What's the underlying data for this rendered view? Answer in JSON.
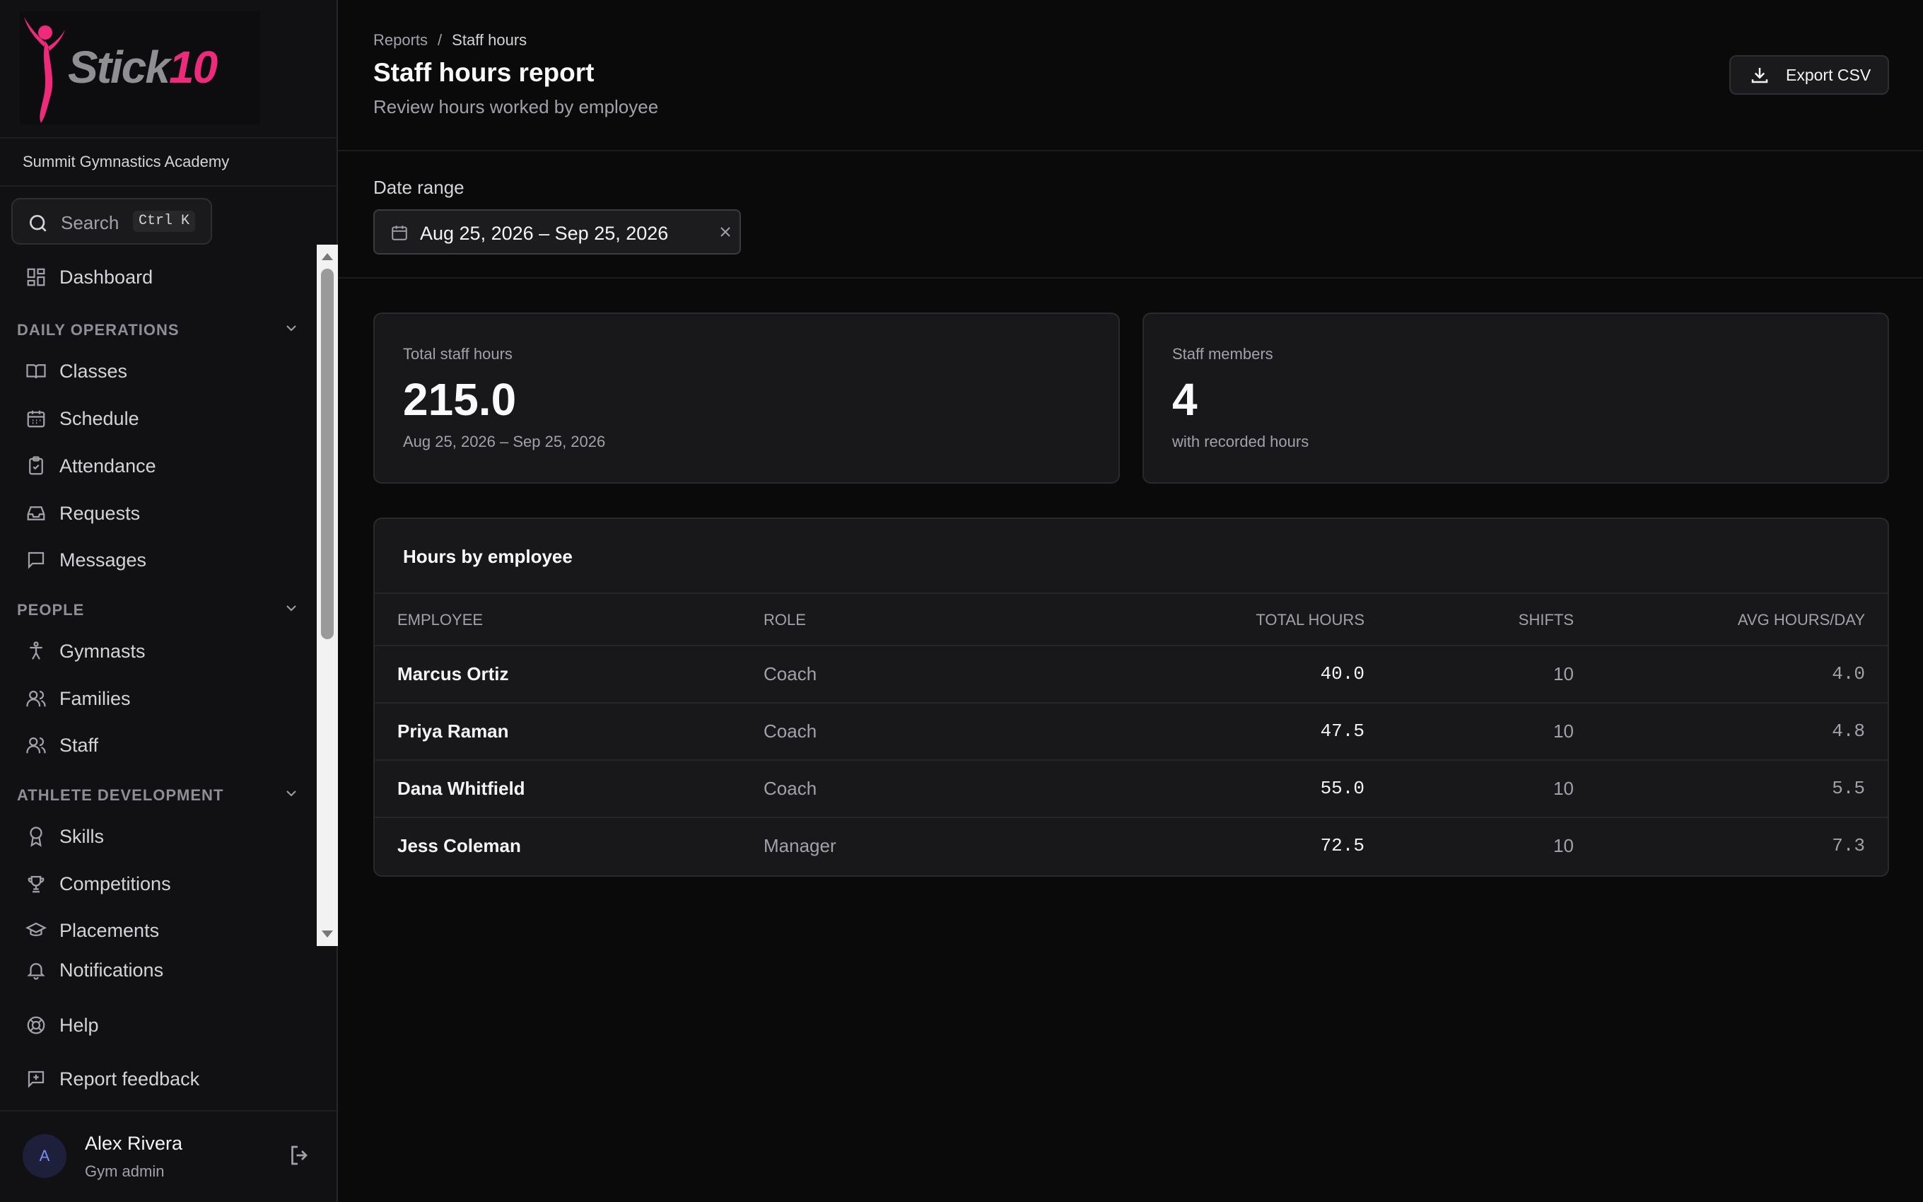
{
  "brand": {
    "logo_text": "Stick",
    "logo_accent": "10",
    "org_name": "Summit Gymnastics Academy",
    "accent_color": "#ee2a7b"
  },
  "search": {
    "label": "Search",
    "shortcut": "Ctrl K"
  },
  "sidebar": {
    "dashboard": {
      "label": "Dashboard",
      "icon": "dashboard-icon"
    },
    "sections": [
      {
        "label": "Daily operations",
        "items": [
          {
            "label": "Classes",
            "icon": "book-icon"
          },
          {
            "label": "Schedule",
            "icon": "calendar-icon"
          },
          {
            "label": "Attendance",
            "icon": "clipboard-check-icon"
          },
          {
            "label": "Requests",
            "icon": "inbox-icon"
          },
          {
            "label": "Messages",
            "icon": "message-icon"
          }
        ]
      },
      {
        "label": "People",
        "items": [
          {
            "label": "Gymnasts",
            "icon": "person-icon"
          },
          {
            "label": "Families",
            "icon": "users-icon"
          },
          {
            "label": "Staff",
            "icon": "users-icon"
          }
        ]
      },
      {
        "label": "Athlete development",
        "items": [
          {
            "label": "Skills",
            "icon": "award-icon"
          },
          {
            "label": "Competitions",
            "icon": "trophy-icon"
          },
          {
            "label": "Placements",
            "icon": "graduation-cap-icon"
          }
        ]
      }
    ],
    "footer_items": [
      {
        "label": "Notifications",
        "icon": "bell-icon"
      },
      {
        "label": "Help",
        "icon": "lifebuoy-icon"
      },
      {
        "label": "Report feedback",
        "icon": "feedback-icon"
      }
    ]
  },
  "user": {
    "initial": "A",
    "name": "Alex Rivera",
    "role": "Gym admin"
  },
  "header": {
    "breadcrumb": [
      "Reports",
      "/",
      "Staff hours"
    ],
    "title": "Staff hours report",
    "subtitle": "Review hours worked by employee",
    "export_label": "Export CSV"
  },
  "filter": {
    "label": "Date range",
    "value": "Aug 25, 2026 – Sep 25, 2026"
  },
  "stats": [
    {
      "label": "Total staff hours",
      "value": "215.0",
      "foot": "Aug 25, 2026 – Sep 25, 2026"
    },
    {
      "label": "Staff members",
      "value": "4",
      "foot": "with recorded hours"
    }
  ],
  "table": {
    "title": "Hours by employee",
    "columns": [
      "Employee",
      "Role",
      "Total hours",
      "Shifts",
      "Avg hours/day"
    ],
    "rows": [
      [
        "Marcus Ortiz",
        "Coach",
        "40.0",
        "10",
        "4.0"
      ],
      [
        "Priya Raman",
        "Coach",
        "47.5",
        "10",
        "4.8"
      ],
      [
        "Dana Whitfield",
        "Coach",
        "55.0",
        "10",
        "5.5"
      ],
      [
        "Jess Coleman",
        "Manager",
        "72.5",
        "10",
        "7.3"
      ]
    ]
  }
}
